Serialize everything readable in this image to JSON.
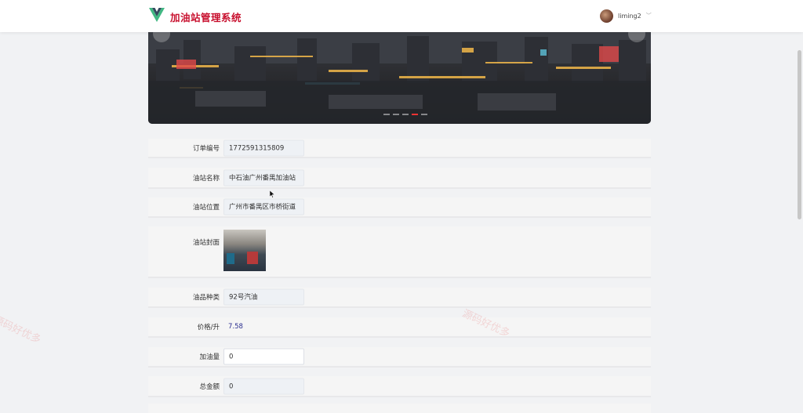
{
  "header": {
    "app_title": "加油站管理系统",
    "username": "liming2",
    "logo_icon": "vue-logo-icon",
    "colors": {
      "brand": "#c8102e",
      "logo_green": "#41b883",
      "logo_dark": "#34495e"
    }
  },
  "form": {
    "order_no": {
      "label": "订单编号",
      "value": "1772591315809"
    },
    "station_name": {
      "label": "油站名称",
      "value": "中石油广州番禺加油站"
    },
    "station_location": {
      "label": "油站位置",
      "value": "广州市番禺区市桥街道"
    },
    "station_cover": {
      "label": "油站封面"
    },
    "oil_type": {
      "label": "油品种类",
      "value": "92号汽油"
    },
    "price": {
      "label": "价格/升",
      "value": "7.58"
    },
    "amount": {
      "label": "加油量",
      "value": "0"
    },
    "total": {
      "label": "总金额",
      "value": "0"
    }
  },
  "watermark": {
    "text": "源码好优多"
  }
}
